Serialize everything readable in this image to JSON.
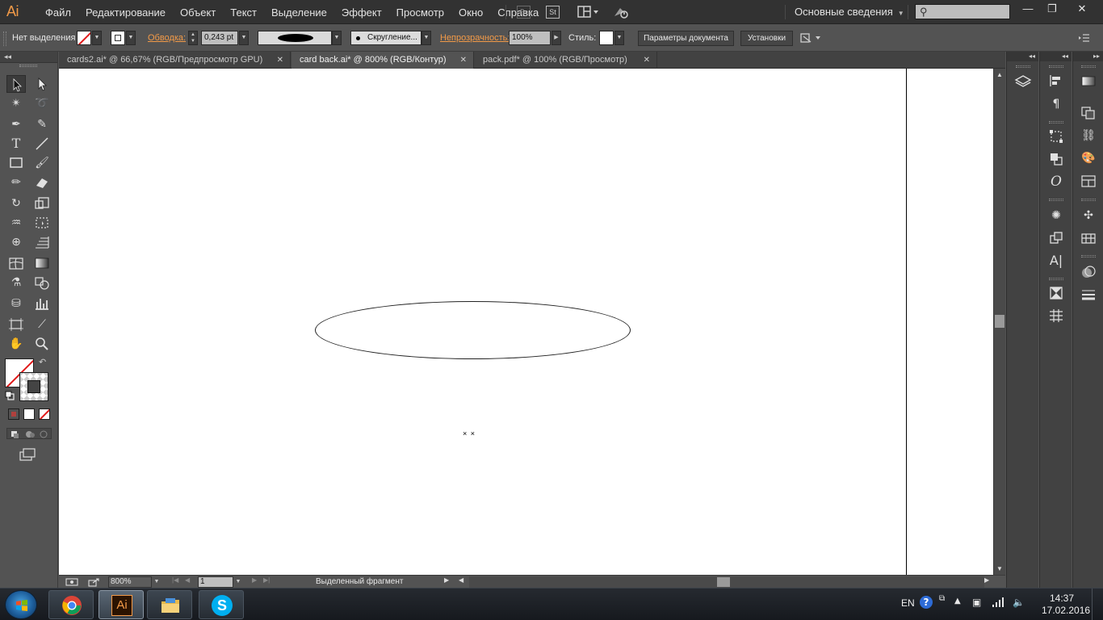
{
  "app": {
    "logo": "Ai"
  },
  "menu": [
    "Файл",
    "Редактирование",
    "Объект",
    "Текст",
    "Выделение",
    "Эффект",
    "Просмотр",
    "Окно",
    "Справка"
  ],
  "menubar_buttons": {
    "bridge": "Br",
    "stock": "St"
  },
  "workspace": {
    "label": "Основные сведения"
  },
  "search": {
    "placeholder": ""
  },
  "window_controls": {
    "minimize": "—",
    "restore": "❐",
    "close": "✕"
  },
  "control": {
    "selection_label": "Нет выделения",
    "stroke_label": "Обводка:",
    "stroke_weight": "0,243 pt",
    "round_label": "Скругление...",
    "opacity_label": "Непрозрачность:",
    "opacity_value": "100%",
    "style_label": "Стиль:",
    "doc_settings": "Параметры документа",
    "preferences": "Установки"
  },
  "tabs": [
    {
      "label": "cards2.ai* @ 66,67% (RGB/Предпросмотр GPU)",
      "active": false
    },
    {
      "label": "card back.ai* @ 800% (RGB/Контур)",
      "active": true
    },
    {
      "label": "pack.pdf* @ 100% (RGB/Просмотр)",
      "active": false
    }
  ],
  "canvas": {
    "cursor_marks": "× ×"
  },
  "status": {
    "zoom": "800%",
    "artboard": "1",
    "text": "Выделенный фрагмент"
  },
  "taskbar": {
    "apps": [
      {
        "icon": "chrome-icon",
        "active": false
      },
      {
        "icon": "illustrator-icon",
        "label": "Ai",
        "active": true
      },
      {
        "icon": "file-explorer-icon",
        "active": false
      },
      {
        "icon": "skype-icon",
        "label": "S",
        "active": false
      }
    ],
    "language": "EN",
    "time": "14:37",
    "date": "17.02.2016"
  },
  "colors": {
    "accent": "#f29a48",
    "none_slash": "#e01919",
    "ui_bg": "#535353",
    "menubar_bg": "#323232"
  }
}
